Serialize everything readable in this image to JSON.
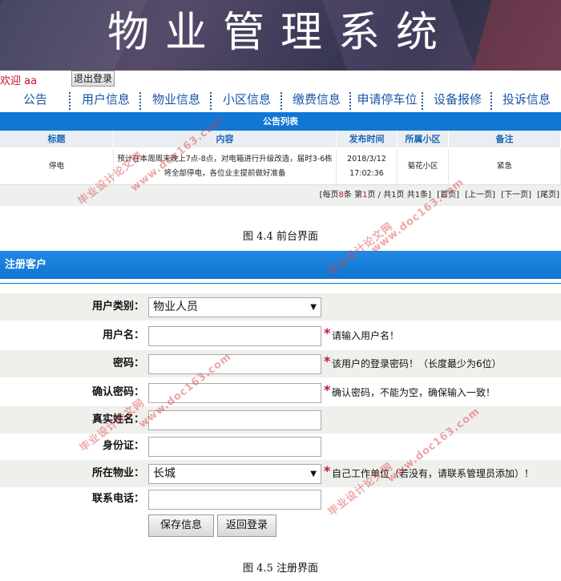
{
  "banner": {
    "title": "物业管理系统"
  },
  "topbar": {
    "welcome": "欢迎 aa",
    "logout": "退出登录"
  },
  "nav": [
    "公告",
    "用户信息",
    "物业信息",
    "小区信息",
    "缴费信息",
    "申请停车位",
    "设备报修",
    "投诉信息"
  ],
  "notice_list": {
    "title": "公告列表",
    "columns": [
      "标题",
      "内容",
      "发布时间",
      "所属小区",
      "备注"
    ],
    "rows": [
      {
        "title": "停电",
        "content": "预计在本周周末晚上7点-8点，对电箱进行升级改造，届时3-6栋将全部停电，各位业主提前做好准备",
        "time": "2018/3/12 17:02:36",
        "community": "菊花小区",
        "remark": "紧急"
      }
    ],
    "pager": {
      "per_page_pre": "[每页",
      "per_page_num": "8",
      "per_page_post": "条 第",
      "page_num": "1",
      "page_post": "页 / 共1页 共1条]",
      "first": "[首页]",
      "prev": "[上一页]",
      "next": "[下一页]",
      "last": "[尾页]"
    }
  },
  "caption1": "图 4.4 前台界面",
  "register": {
    "header": "注册客户",
    "fields": {
      "user_type": {
        "label": "用户类别：",
        "value": "物业人员"
      },
      "username": {
        "label": "用户名：",
        "value": "",
        "hint": "请输入用户名！"
      },
      "password": {
        "label": "密码：",
        "value": "",
        "hint": "该用户的登录密码！（长度最少为6位）"
      },
      "confirm": {
        "label": "确认密码：",
        "value": "",
        "hint": "确认密码，不能为空，确保输入一致！"
      },
      "realname": {
        "label": "真实姓名：",
        "value": ""
      },
      "idcard": {
        "label": "身份证：",
        "value": ""
      },
      "property": {
        "label": "所在物业：",
        "value": "长城",
        "hint": "自己工作单位（若没有，请联系管理员添加）！"
      },
      "phone": {
        "label": "联系电话：",
        "value": ""
      }
    },
    "required_mark": "*",
    "save": "保存信息",
    "back": "返回登录"
  },
  "caption2": "图 4.5 注册界面",
  "watermark": {
    "cn": "毕业设计论文网",
    "url": "www.doc163.com"
  },
  "colors": {
    "accent": "#1274cd",
    "nav_text": "#1a56a8",
    "required": "#c8102e"
  }
}
